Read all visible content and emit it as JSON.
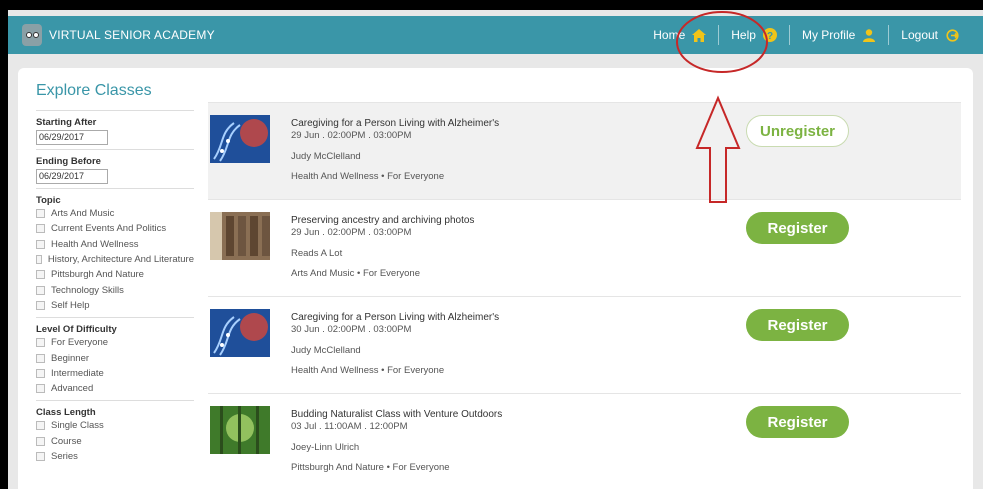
{
  "brand": {
    "name": "VIRTUAL SENIOR ACADEMY"
  },
  "nav": {
    "items": [
      {
        "label": "Home",
        "icon": "home-icon"
      },
      {
        "label": "Help",
        "icon": "help-icon"
      },
      {
        "label": "My Profile",
        "icon": "user-icon"
      },
      {
        "label": "Logout",
        "icon": "logout-icon"
      }
    ]
  },
  "explore": {
    "title": "Explore Classes"
  },
  "filters": {
    "starting_after": {
      "label": "Starting After",
      "value": "06/29/2017"
    },
    "ending_before": {
      "label": "Ending Before",
      "value": "06/29/2017"
    },
    "topic": {
      "label": "Topic",
      "options": [
        "Arts And Music",
        "Current Events And Politics",
        "Health And Wellness",
        "History, Architecture And Literature",
        "Pittsburgh And Nature",
        "Technology Skills",
        "Self Help"
      ]
    },
    "difficulty": {
      "label": "Level Of Difficulty",
      "options": [
        "For Everyone",
        "Beginner",
        "Intermediate",
        "Advanced"
      ]
    },
    "length": {
      "label": "Class Length",
      "options": [
        "Single Class",
        "Course",
        "Series"
      ]
    }
  },
  "classes": [
    {
      "title": "Caregiving for a Person Living with Alzheimer's",
      "time": "29 Jun . 02:00PM . 03:00PM",
      "leader": "Judy McClelland",
      "meta": "Health And Wellness • For Everyone",
      "action": "Unregister"
    },
    {
      "title": "Preserving ancestry and archiving photos",
      "time": "29 Jun . 02:00PM . 03:00PM",
      "leader": "Reads A Lot",
      "meta": "Arts And Music • For Everyone",
      "action": "Register"
    },
    {
      "title": "Caregiving for a Person Living with Alzheimer's",
      "time": "30 Jun . 02:00PM . 03:00PM",
      "leader": "Judy McClelland",
      "meta": "Health And Wellness • For Everyone",
      "action": "Register"
    },
    {
      "title": "Budding Naturalist Class with Venture Outdoors",
      "time": "03 Jul . 11:00AM . 12:00PM",
      "leader": "Joey-Linn Ulrich",
      "meta": "Pittsburgh And Nature • For Everyone",
      "action": "Register"
    }
  ],
  "colors": {
    "header": "#3a96a8",
    "accent": "#3a96a8",
    "button": "#7cb342",
    "annotation": "#c62828"
  }
}
